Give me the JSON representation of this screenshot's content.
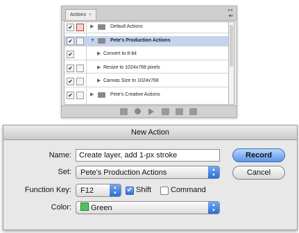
{
  "actions_panel": {
    "tab_label": "Actions",
    "tab_close": "×",
    "rows": [
      {
        "label": "Default Actions",
        "checked": true,
        "dialog_red": true,
        "type": "set"
      },
      {
        "label": "Pete's Production Actions",
        "checked": true,
        "dialog_red": false,
        "type": "set",
        "selected": true
      },
      {
        "label": "Convert to 8-bit",
        "checked": true,
        "type": "action"
      },
      {
        "label": "Resize to 1024x768 pixels",
        "checked": true,
        "type": "action"
      },
      {
        "label": "Canvas Size to 1024x768",
        "checked": true,
        "type": "action"
      },
      {
        "label": "Pete's Creative Actions",
        "checked": true,
        "type": "set"
      }
    ]
  },
  "dialog": {
    "title": "New Action",
    "name_label": "Name:",
    "name_value": "Create layer, add 1-px stroke",
    "set_label": "Set:",
    "set_value": "Pete's Production Actions",
    "function_key_label": "Function Key:",
    "function_key_value": "F12",
    "shift_label": "Shift",
    "command_label": "Command",
    "color_label": "Color:",
    "color_value": "Green",
    "record_label": "Record",
    "cancel_label": "Cancel"
  },
  "colors": {
    "selection": "#c4d4ee",
    "accent_blue": "#2a6fd6",
    "swatch_green": "#4fc45a"
  }
}
